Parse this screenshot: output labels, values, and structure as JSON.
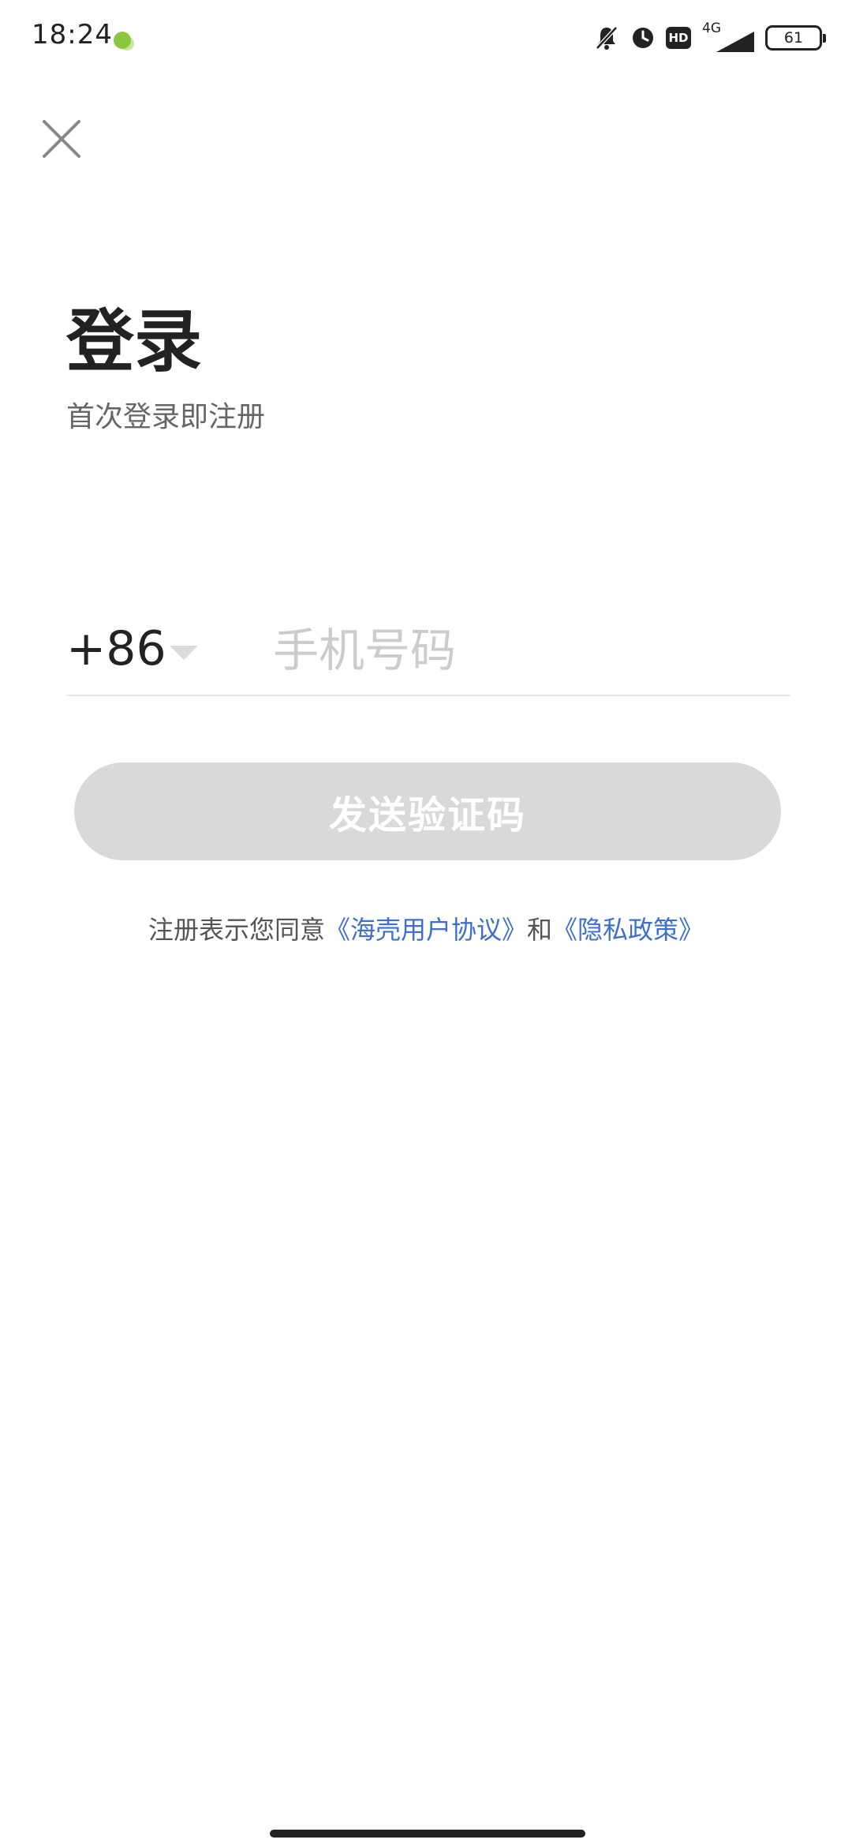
{
  "status_bar": {
    "time": "18:24",
    "hd_badge": "HD",
    "network_type": "4G",
    "battery_level": "61",
    "icons": [
      "app-notification-icon",
      "mute-icon",
      "alarm-icon",
      "hd-icon",
      "signal-icon",
      "battery-icon"
    ]
  },
  "header": {
    "close_icon": "close-icon"
  },
  "login": {
    "title": "登录",
    "subtitle": "首次登录即注册",
    "country_code": "+86",
    "phone_placeholder": "手机号码",
    "send_code_label": "发送验证码"
  },
  "agreement": {
    "prefix": "注册表示您同意",
    "user_agreement": "《海壳用户协议》",
    "conjunction": "和",
    "privacy_policy": "《隐私政策》"
  },
  "colors": {
    "text_primary": "#222222",
    "text_secondary": "#666666",
    "placeholder": "#cccccc",
    "button_disabled": "#d9d9d9",
    "link": "#3d6fd1"
  }
}
